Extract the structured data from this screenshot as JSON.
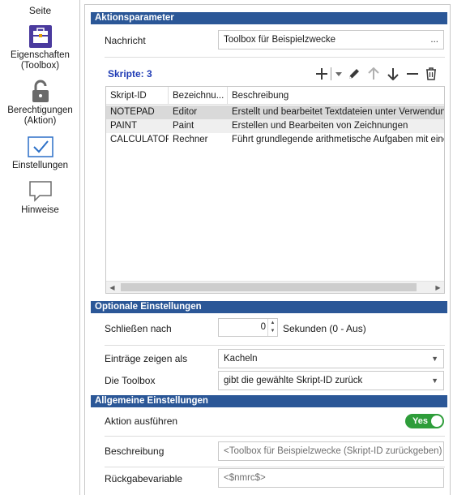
{
  "sidebar": {
    "title": "Seite",
    "items": [
      {
        "label": "Eigenschaften\n(Toolbox)",
        "icon": "toolbox-icon"
      },
      {
        "label": "Berechtigungen\n(Aktion)",
        "icon": "lock-icon"
      },
      {
        "label": "Einstellungen",
        "icon": "checkmark-icon"
      },
      {
        "label": "Hinweise",
        "icon": "speech-bubble-icon"
      }
    ]
  },
  "sections": {
    "aktionsparameter": "Aktionsparameter",
    "optionale": "Optionale Einstellungen",
    "allgemeine": "Allgemeine Einstellungen"
  },
  "nachricht": {
    "label": "Nachricht",
    "value": "Toolbox für Beispielzwecke",
    "button": "..."
  },
  "skripte": {
    "label": "Skripte: 3",
    "toolbar": [
      "add-icon",
      "dropdown-arrow-icon",
      "edit-pencil-icon",
      "move-up-icon",
      "move-down-icon",
      "remove-icon",
      "delete-icon"
    ],
    "columns": [
      "Skript-ID",
      "Bezeichnu...",
      "Beschreibung"
    ],
    "rows": [
      [
        "NOTEPAD",
        "Editor",
        "Erstellt und bearbeitet Textdateien unter Verwendung"
      ],
      [
        "PAINT",
        "Paint",
        "Erstellen und Bearbeiten von Zeichnungen"
      ],
      [
        "CALCULATOR",
        "Rechner",
        "Führt grundlegende arithmetische Aufgaben mit einem"
      ]
    ]
  },
  "schliessen": {
    "label": "Schließen nach",
    "value": "0",
    "unit": "Sekunden (0 - Aus)"
  },
  "eintraege": {
    "label": "Einträge zeigen als",
    "value": "Kacheln"
  },
  "toolbox": {
    "label": "Die Toolbox",
    "value": "gibt die gewählte Skript-ID zurück"
  },
  "aktion": {
    "label": "Aktion ausführen",
    "toggle": "Yes"
  },
  "beschreibung": {
    "label": "Beschreibung",
    "value": "<Toolbox für Beispielzwecke (Skript-ID zurückgeben) ..."
  },
  "rueckgabe": {
    "label": "Rückgabevariable",
    "value": "<$nmrc$>"
  },
  "colors": {
    "header": "#2b5797",
    "toggle": "#2e9d3a",
    "accent": "#1f3bb5"
  }
}
